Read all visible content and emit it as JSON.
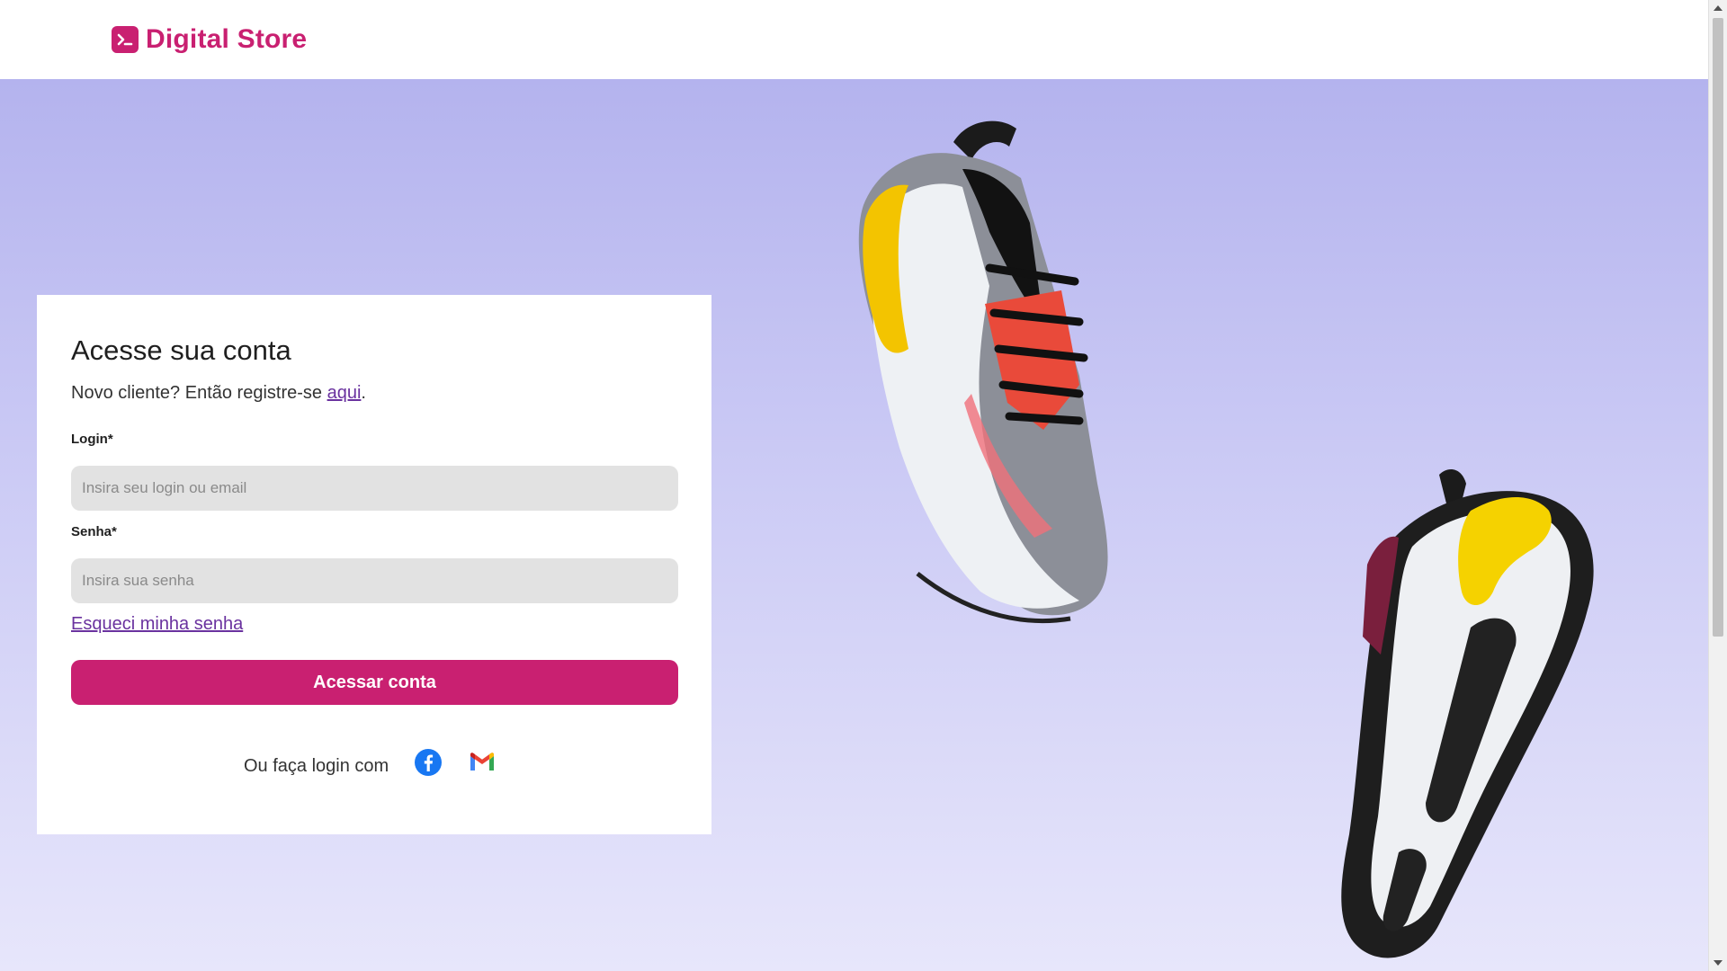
{
  "header": {
    "brand_name": "Digital Store",
    "brand_icon": "terminal-logo-icon",
    "brand_color": "#c92071"
  },
  "login": {
    "title": "Acesse sua conta",
    "subtitle_prefix": "Novo cliente? Então registre-se ",
    "register_link": "aqui",
    "subtitle_suffix": ".",
    "login_label": "Login*",
    "login_placeholder": "Insira seu login ou email",
    "password_label": "Senha*",
    "password_placeholder": "Insira sua senha",
    "forgot_link": "Esqueci minha senha",
    "submit_label": "Acessar conta",
    "social_label": "Ou faça login com",
    "social_icons": [
      "facebook-icon",
      "gmail-icon"
    ]
  },
  "colors": {
    "accent": "#c92071",
    "link": "#6a329f",
    "input_bg": "#e2e2e2"
  }
}
